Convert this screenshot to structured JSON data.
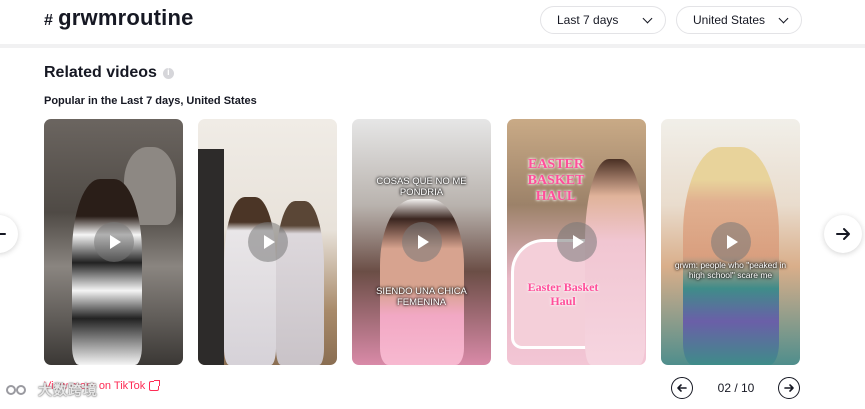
{
  "header": {
    "hash_symbol": "#",
    "hashtag": "grwmroutine",
    "period_filter": "Last 7 days",
    "country_filter": "United States"
  },
  "section": {
    "title": "Related videos",
    "subtitle": "Popular in the Last 7 days, United States",
    "more_link": "View more on TikTok"
  },
  "videos": [
    {
      "caption_top": "",
      "caption_bottom": ""
    },
    {
      "caption_top": "",
      "caption_bottom": ""
    },
    {
      "caption_top": "COSAS QUE NO ME PONDRIA",
      "caption_bottom": "SIENDO UNA CHICA FEMENINA"
    },
    {
      "caption_top": "EASTER BASKET HAUL",
      "caption_bottom": "Easter Basket Haul"
    },
    {
      "caption_top": "",
      "caption_bottom": "grwm: people who \"peaked in high school\" scare me"
    }
  ],
  "pagination": {
    "label": "02 / 10"
  },
  "watermark": {
    "text": "大数跨境"
  },
  "colors": {
    "accent": "#fe2c55",
    "text": "#161823",
    "border": "#e3e3e6"
  }
}
